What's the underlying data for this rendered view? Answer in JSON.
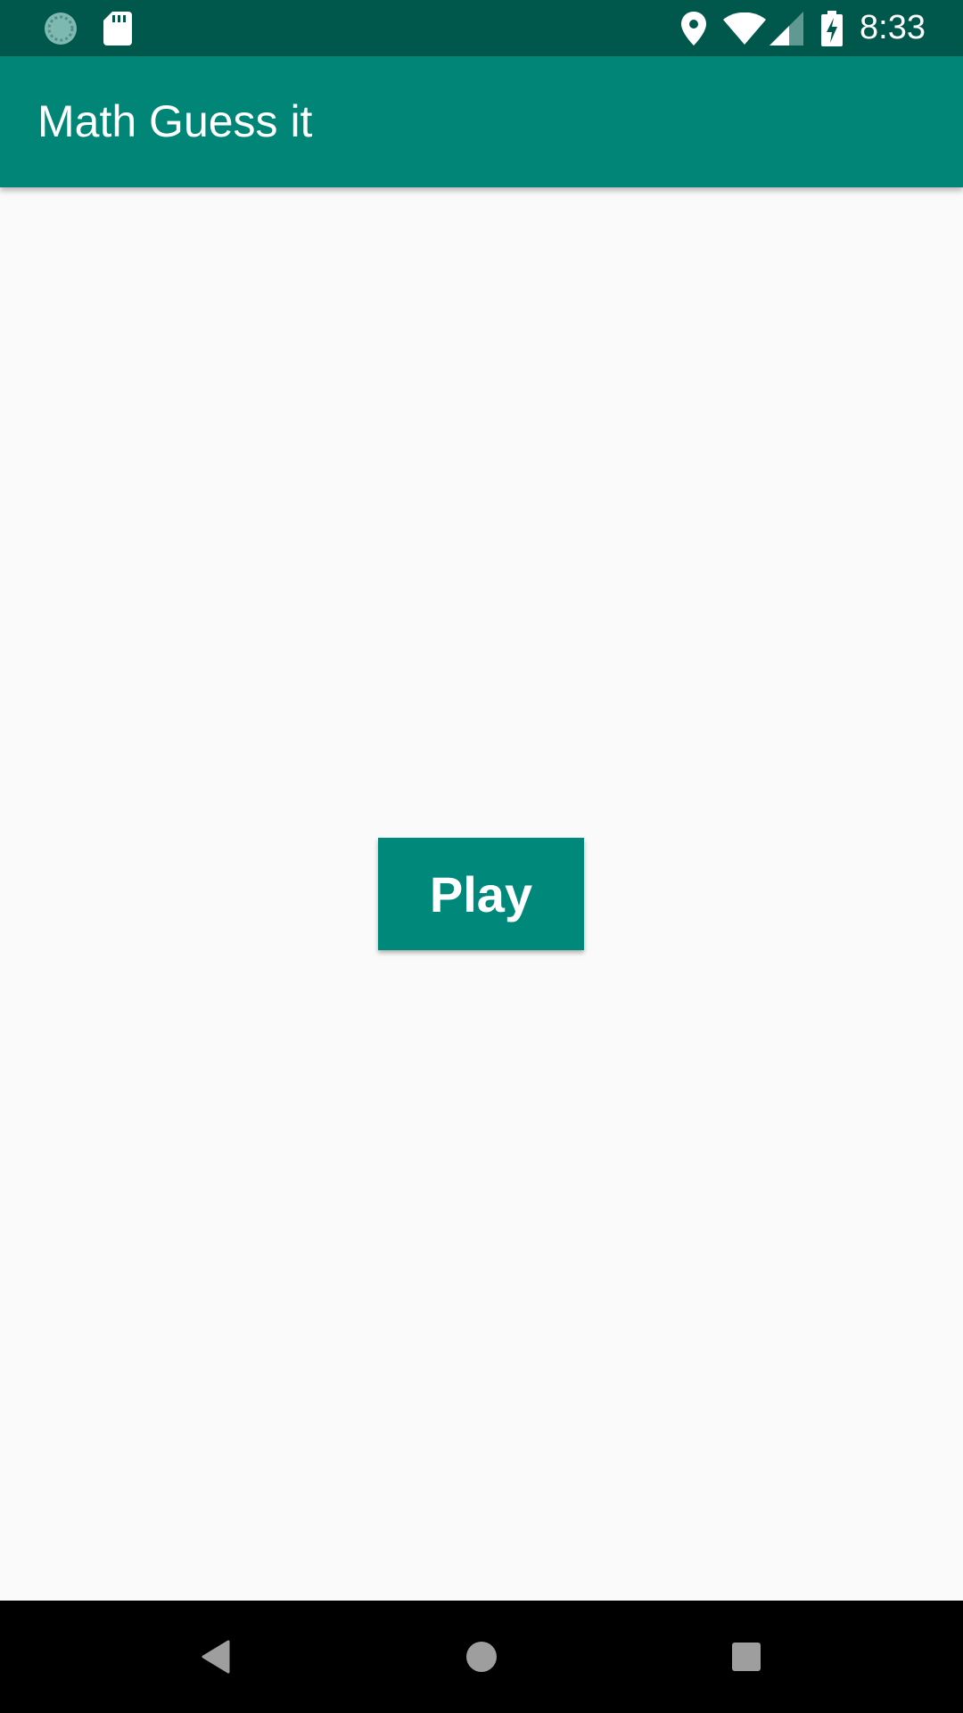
{
  "status_bar": {
    "time": "8:33",
    "left_icons": [
      "sync-icon",
      "sd-card-icon"
    ],
    "right_icons": [
      "location-icon",
      "wifi-icon",
      "signal-icon",
      "battery-charging-icon"
    ],
    "background_color": "#00574b"
  },
  "app_bar": {
    "title": "Math Guess it",
    "background_color": "#008577"
  },
  "main": {
    "play_button_label": "Play",
    "play_button_color": "#00897b"
  },
  "nav_bar": {
    "buttons": [
      "back-icon",
      "home-icon",
      "recents-icon"
    ]
  }
}
